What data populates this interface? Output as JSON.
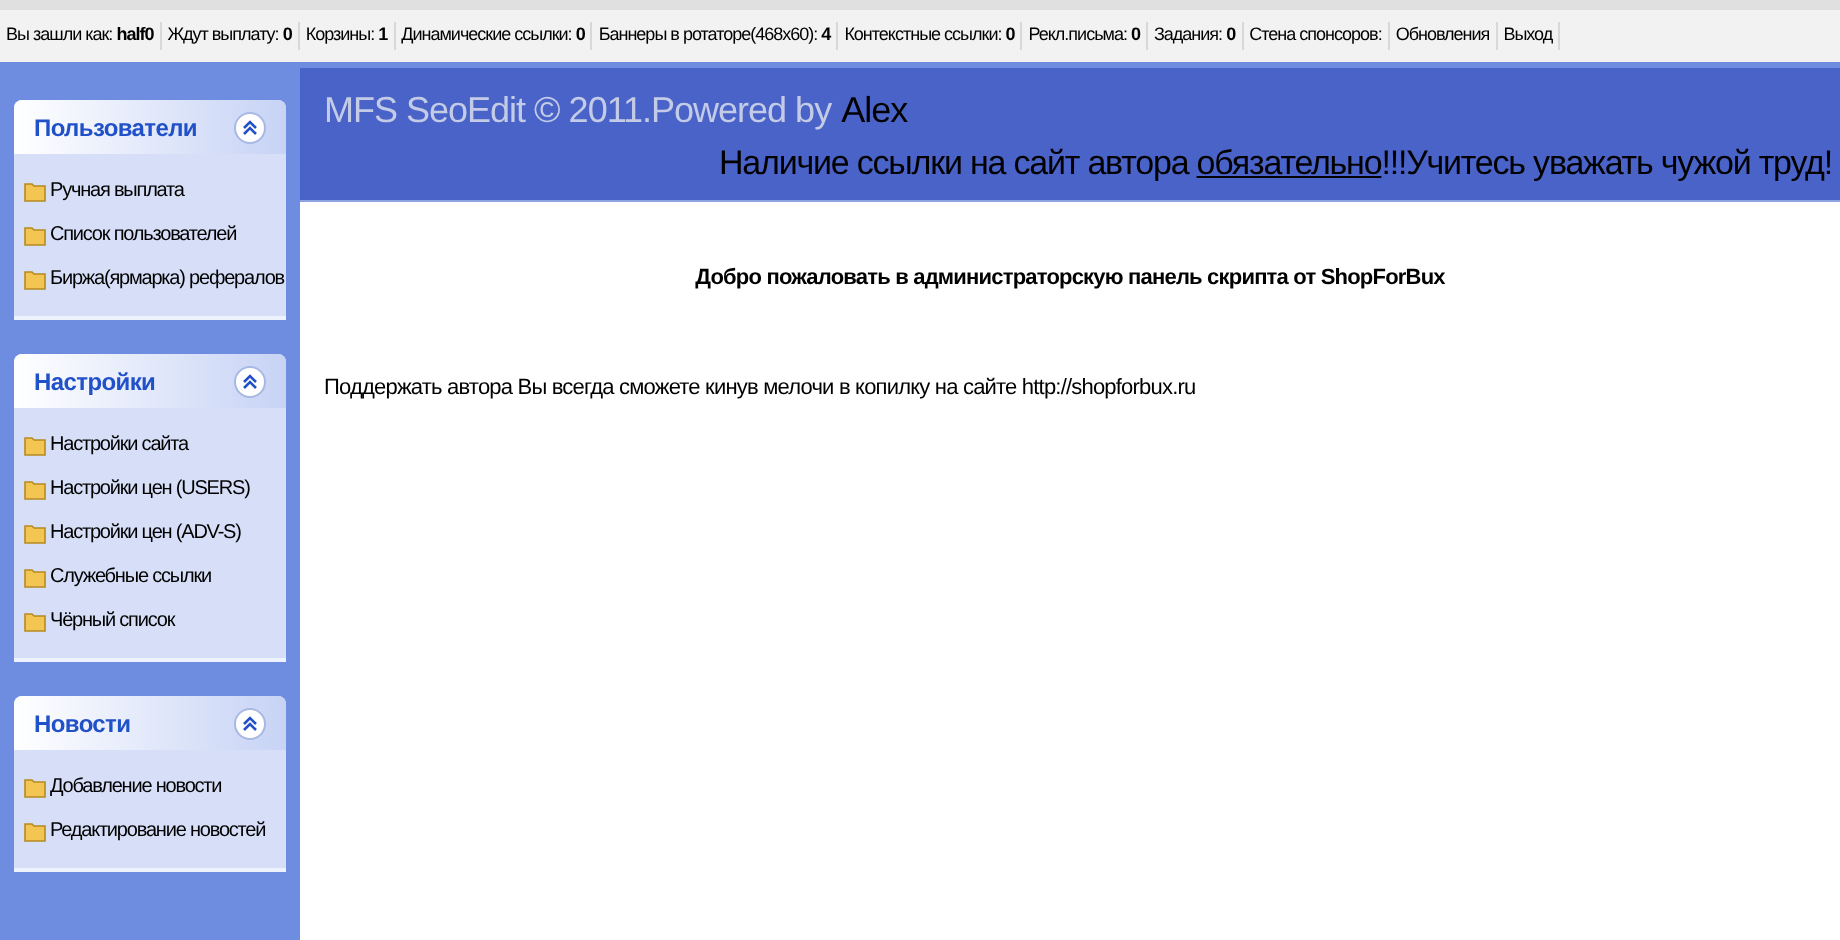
{
  "top_bar": {
    "items": [
      {
        "label": "Вы зашли как:",
        "value": "half0"
      },
      {
        "label": "Ждут выплату:",
        "value": "0"
      },
      {
        "label": "Корзины:",
        "value": "1"
      },
      {
        "label": "Динамические ссылки:",
        "value": "0"
      },
      {
        "label": "Баннеры в ротаторе(468x60):",
        "value": "4"
      },
      {
        "label": "Контекстные ссылки:",
        "value": "0"
      },
      {
        "label": "Рекл.письма:",
        "value": "0"
      },
      {
        "label": "Задания:",
        "value": "0"
      },
      {
        "label": "Стена спонсоров:"
      },
      {
        "label": "Обновления"
      },
      {
        "label": "Выход"
      }
    ]
  },
  "sidebar": {
    "panels": [
      {
        "title": "Пользователи",
        "expanded": true,
        "items": [
          "Ручная выплата",
          "Список пользователей",
          "Биржа(ярмарка) рефералов"
        ]
      },
      {
        "title": "Настройки",
        "expanded": true,
        "items": [
          "Настройки сайта",
          "Настройки цен (USERS)",
          "Настройки цен (ADV-S)",
          "Служебные ссылки",
          "Чёрный список"
        ]
      },
      {
        "title": "Новости",
        "expanded": true,
        "items": [
          "Добавление новости",
          "Редактирование новостей"
        ]
      }
    ]
  },
  "header": {
    "title": "MFS SeoEdit © 2011.Powered by",
    "author": "Alex",
    "notice_before": "Наличие ссылки на сайт автора",
    "notice_link": "обязательно",
    "notice_after": "!!!Учитесь уважать чужой труд!"
  },
  "content": {
    "welcome": "Добро пожаловать в администраторскую панель скрипта от ShopForBux",
    "support": "Поддержать автора Вы всегда сможете кинув мелочи в копилку на сайте http://shopforbux.ru"
  }
}
